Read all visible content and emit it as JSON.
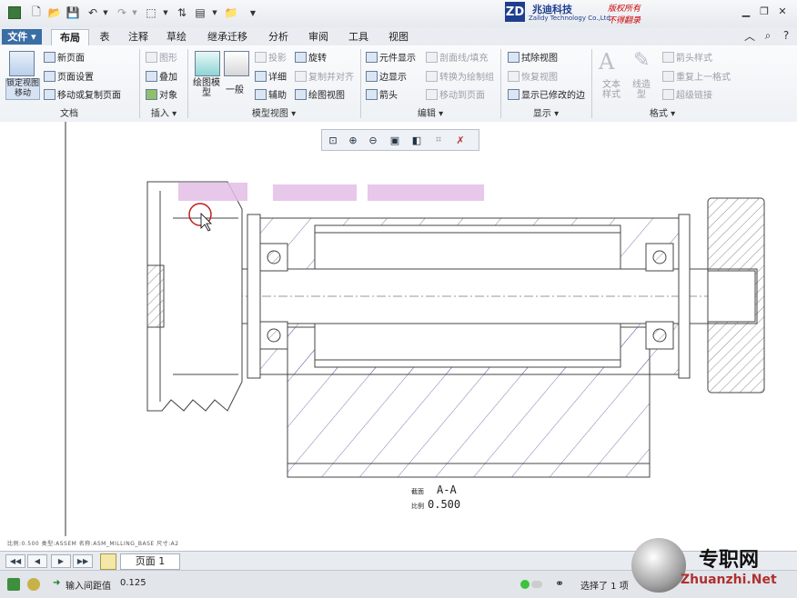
{
  "title_bar": {
    "company_cn": "兆迪科技",
    "company_en": "Zalldy Technology Co.,Ltd",
    "logo_mark": "ZD",
    "watermark_1": "版权所有",
    "watermark_2": "不得翻录"
  },
  "tabs": [
    "文件",
    "布局",
    "表",
    "注释",
    "草绘",
    "继承迁移",
    "分析",
    "审阅",
    "工具",
    "视图"
  ],
  "ribbon": {
    "doc": {
      "lock_view": "锁定视图移动",
      "new_page": "新页面",
      "page_setup": "页面设置",
      "move_copy_page": "移动或复制页面",
      "group": "文档"
    },
    "insert": {
      "graphics": "图形",
      "overlay": "叠加",
      "object": "对象",
      "group": "插入"
    },
    "model_views": {
      "drawing_model": "绘图模型",
      "general": "一般",
      "projection": "投影",
      "detailed": "详细",
      "auxiliary": "辅助",
      "revolve": "旋转",
      "copy_align": "复制并对齐",
      "drawing_view": "绘图视图",
      "group": "模型视图"
    },
    "edit": {
      "element_display": "元件显示",
      "edge_display": "边显示",
      "arrow": "箭头",
      "section_fill": "剖面线/填充",
      "convert_to_draw": "转换为绘制组",
      "move_to_page": "移动到页面",
      "group": "编辑"
    },
    "display": {
      "erase_view": "拭除视图",
      "restore_view": "恢复视图",
      "show_modified": "显示已修改的边",
      "group": "显示"
    },
    "format": {
      "text_style": "文本样式",
      "line_style": "线造型",
      "arrow_style": "箭头样式",
      "repeat_format": "重复上一格式",
      "hyperlink": "超级链接",
      "group": "格式"
    }
  },
  "drawing": {
    "section_label": "截面",
    "section_name": "A-A",
    "scale_label": "比例",
    "scale_value": "0.500"
  },
  "status_small": "比例:0.500  类型:ASSEM  名称:ASM_MILLING_BASE  尺寸:A2",
  "page_tab": "页面 1",
  "status": {
    "prompt_label": "输入间距值",
    "prompt_value": "0.125",
    "selected": "选择了 1 项"
  },
  "site_watermark": {
    "cn": "专职网",
    "en": "Zhuanzhi.Net"
  }
}
